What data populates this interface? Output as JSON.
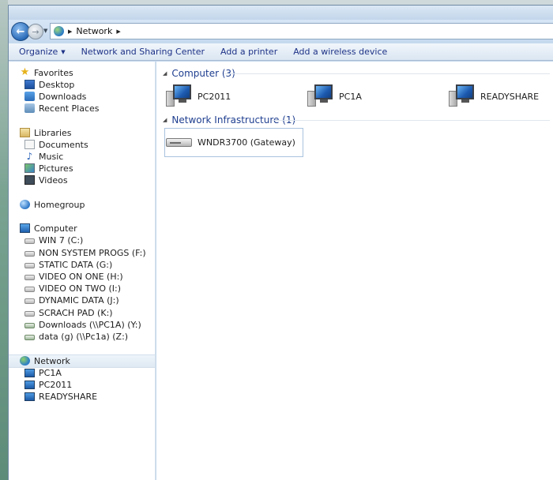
{
  "window": {
    "breadcrumb": "Network"
  },
  "toolbar": {
    "organize": "Organize",
    "network_sharing": "Network and Sharing Center",
    "add_printer": "Add a printer",
    "add_wireless": "Add a wireless device"
  },
  "nav": {
    "favorites": {
      "label": "Favorites",
      "items": [
        "Desktop",
        "Downloads",
        "Recent Places"
      ]
    },
    "libraries": {
      "label": "Libraries",
      "items": [
        "Documents",
        "Music",
        "Pictures",
        "Videos"
      ]
    },
    "homegroup": "Homegroup",
    "computer": {
      "label": "Computer",
      "items": [
        "WIN 7 (C:)",
        "NON SYSTEM PROGS (F:)",
        "STATIC DATA (G:)",
        "VIDEO ON ONE (H:)",
        "VIDEO ON TWO (I:)",
        "DYNAMIC DATA (J:)",
        "SCRACH PAD (K:)",
        "Downloads (\\\\PC1A) (Y:)",
        "data (g) (\\\\Pc1a) (Z:)"
      ]
    },
    "network": {
      "label": "Network",
      "items": [
        "PC1A",
        "PC2011",
        "READYSHARE"
      ]
    }
  },
  "content": {
    "computer_group": "Computer (3)",
    "computers": [
      "PC2011",
      "PC1A",
      "READYSHARE"
    ],
    "infra_group": "Network Infrastructure (1)",
    "infra_items": [
      "WNDR3700 (Gateway)"
    ]
  },
  "icons": {
    "back": "back-arrow-icon",
    "forward": "forward-arrow-icon"
  }
}
